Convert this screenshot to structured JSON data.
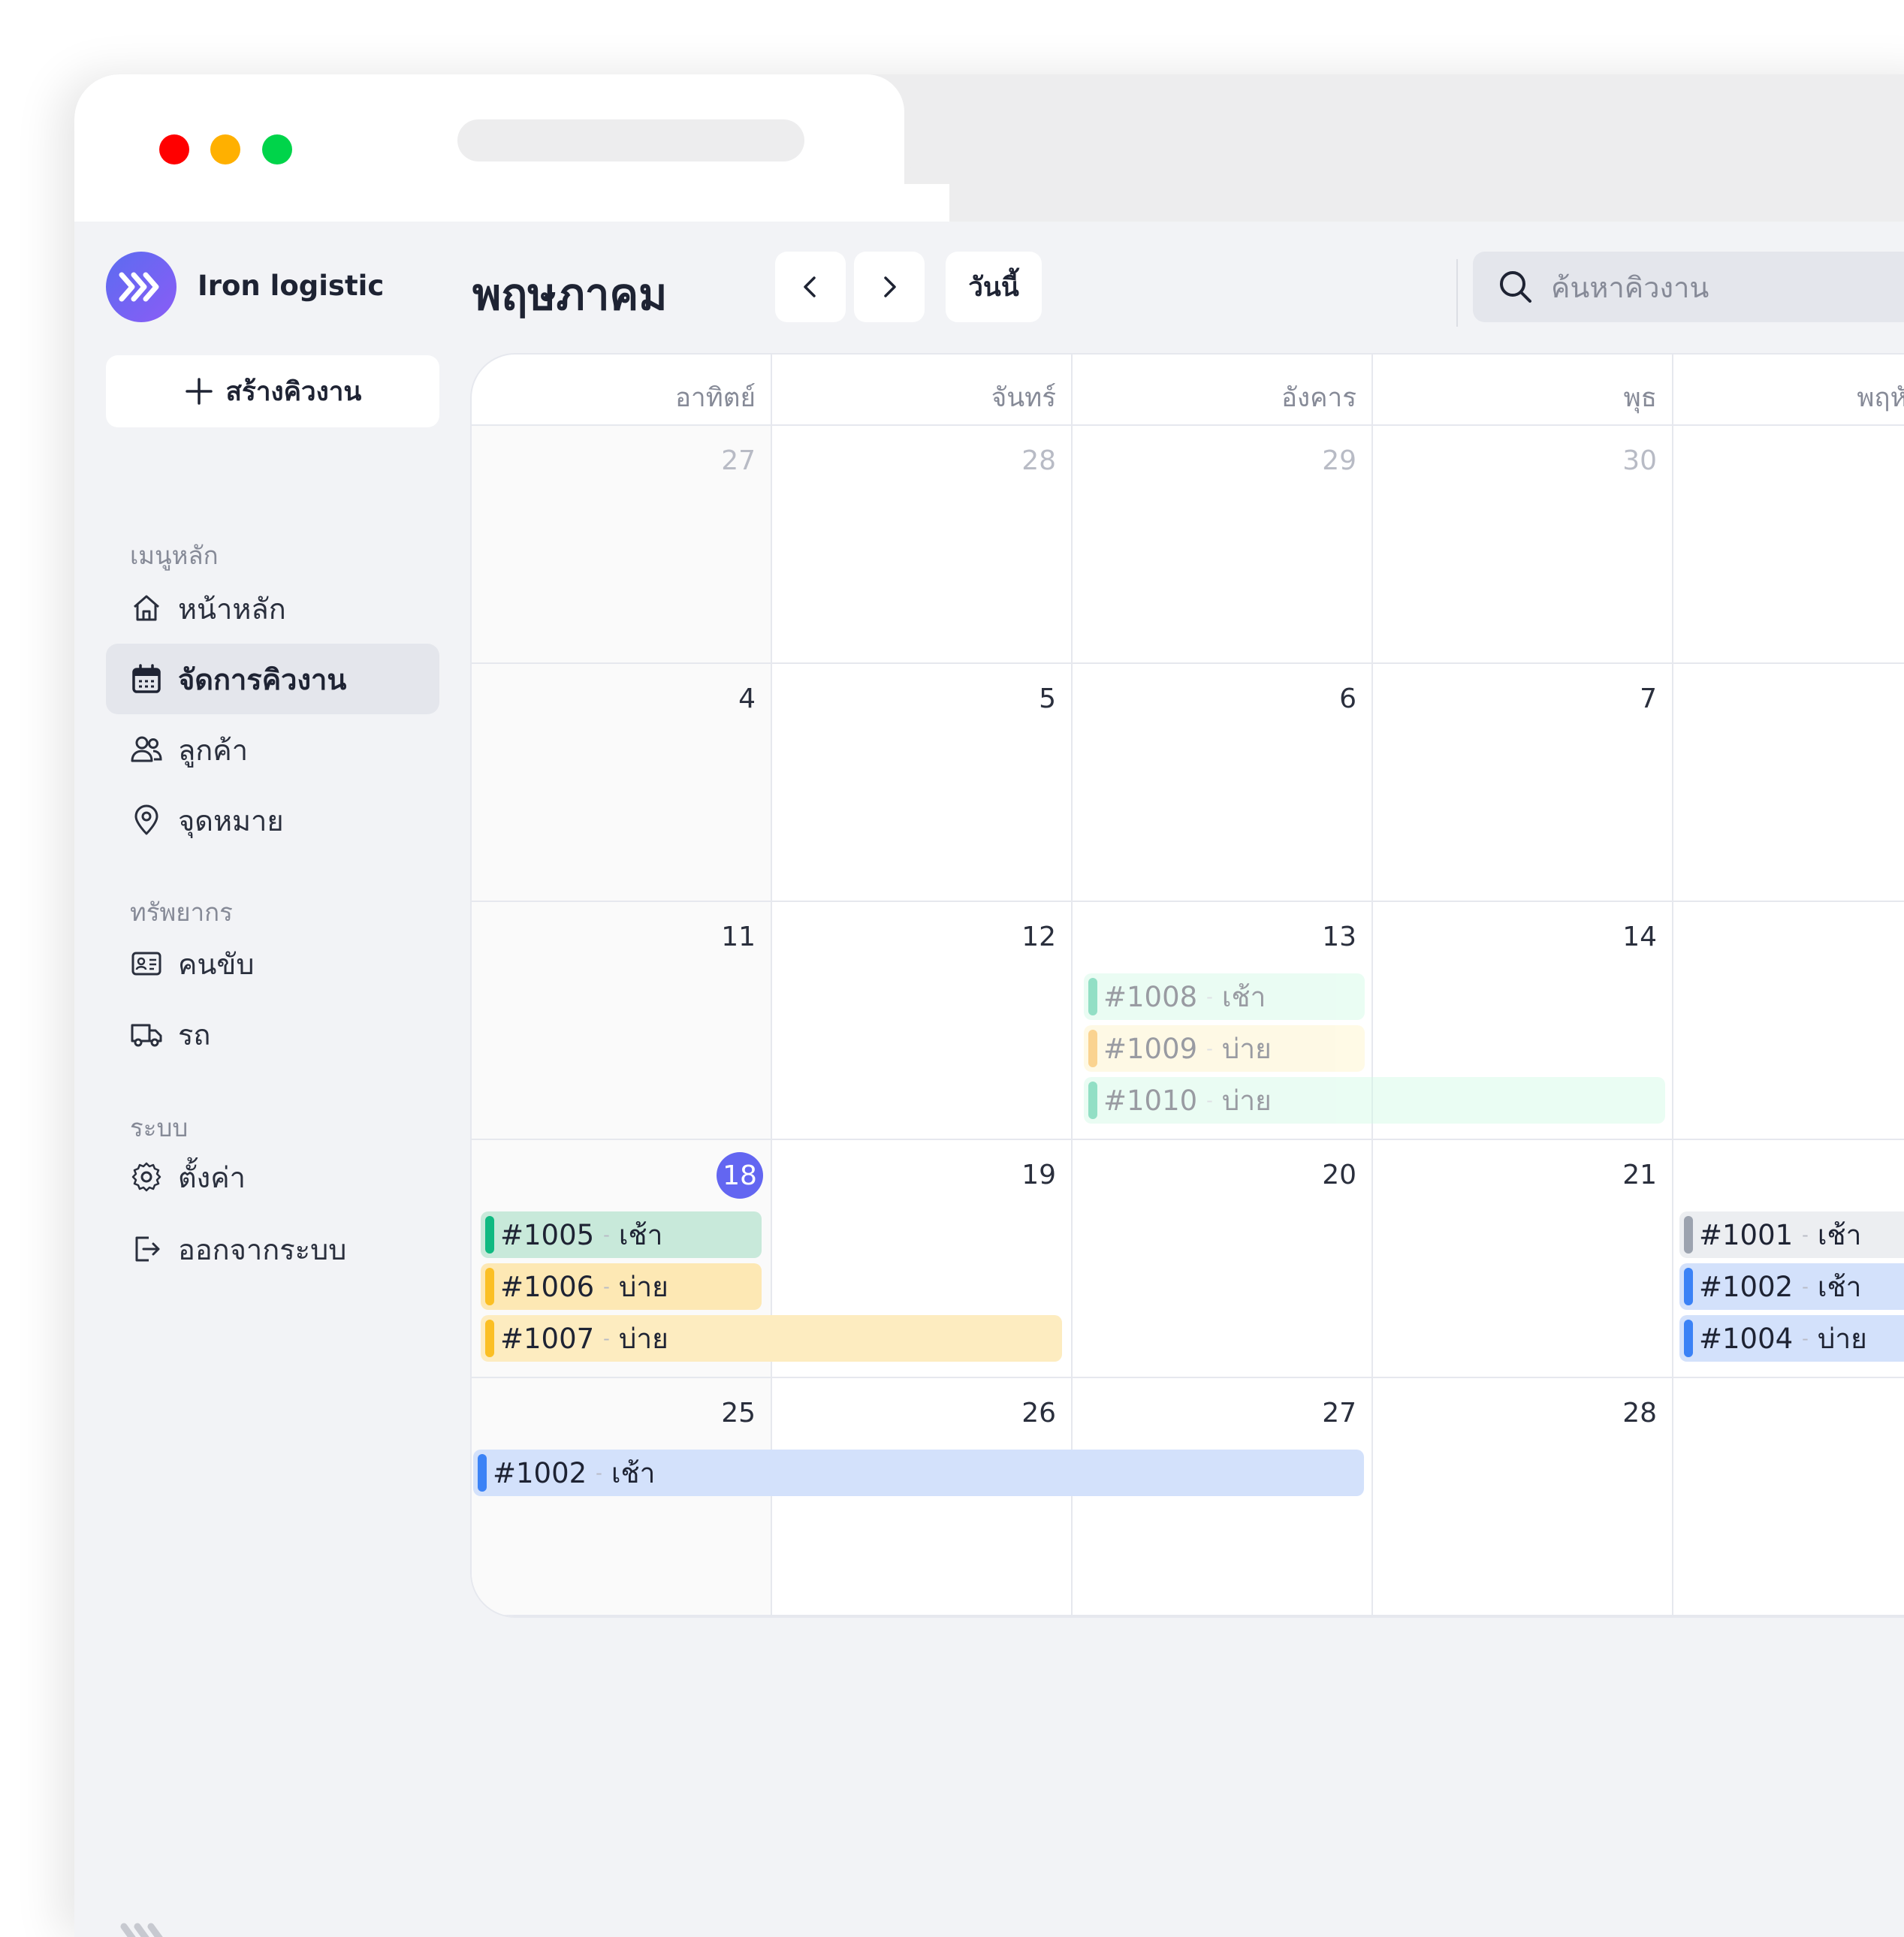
{
  "app": {
    "name": "Iron logistic",
    "create_label": "สร้างคิวงาน"
  },
  "sidebar": {
    "sections": [
      {
        "label": "เมนูหลัก",
        "items": [
          {
            "label": "หน้าหลัก",
            "icon": "home-icon"
          },
          {
            "label": "จัดการคิวงาน",
            "icon": "calendar-icon",
            "active": true
          },
          {
            "label": "ลูกค้า",
            "icon": "users-icon"
          },
          {
            "label": "จุดหมาย",
            "icon": "map-pin-icon"
          }
        ]
      },
      {
        "label": "ทรัพยากร",
        "items": [
          {
            "label": "คนขับ",
            "icon": "id-card-icon"
          },
          {
            "label": "รถ",
            "icon": "truck-icon"
          }
        ]
      },
      {
        "label": "ระบบ",
        "items": [
          {
            "label": "ตั้งค่า",
            "icon": "gear-icon"
          },
          {
            "label": "ออกจากระบบ",
            "icon": "logout-icon"
          }
        ]
      }
    ]
  },
  "header": {
    "month": "พฤษภาคม",
    "today_label": "วันนี้",
    "search_placeholder": "ค้นหาคิวงาน"
  },
  "calendar": {
    "weekdays": [
      "อาทิตย์",
      "จันทร์",
      "อังคาร",
      "พุธ",
      "พฤหัสบดี"
    ],
    "weeks": [
      [
        "27",
        "28",
        "29",
        "30",
        ""
      ],
      [
        "4",
        "5",
        "6",
        "7",
        ""
      ],
      [
        "11",
        "12",
        "13",
        "14",
        ""
      ],
      [
        "18",
        "19",
        "20",
        "21",
        ""
      ],
      [
        "25",
        "26",
        "27",
        "28",
        ""
      ]
    ],
    "today": "18",
    "events": [
      {
        "id": "#1008",
        "shift": "เช้า",
        "color": "#10b981",
        "bg": "#d1fae5",
        "faded": true
      },
      {
        "id": "#1009",
        "shift": "บ่าย",
        "color": "#f59e0b",
        "bg": "#fef3c7",
        "faded": true
      },
      {
        "id": "#1010",
        "shift": "บ่าย",
        "color": "#10b981",
        "bg": "#d1fae5",
        "faded": true
      },
      {
        "id": "#1005",
        "shift": "เช้า",
        "color": "#10b981",
        "bg": "#c8e9da"
      },
      {
        "id": "#1006",
        "shift": "บ่าย",
        "color": "#fbbf24",
        "bg": "#fde8b4"
      },
      {
        "id": "#1007",
        "shift": "บ่าย",
        "color": "#fbbf24",
        "bg": "#fdecc0"
      },
      {
        "id": "#1001",
        "shift": "เช้า",
        "color": "#9ca3af",
        "bg": "#eceef1"
      },
      {
        "id": "#1002",
        "shift": "เช้า",
        "color": "#3b82f6",
        "bg": "#d3e1fb"
      },
      {
        "id": "#1004",
        "shift": "บ่าย",
        "color": "#3b82f6",
        "bg": "#d3e1fb"
      },
      {
        "id": "#1002",
        "shift": "เช้า",
        "color": "#3b82f6",
        "bg": "#d3e1fb"
      }
    ]
  },
  "colors": {
    "accent": "#6366f1",
    "traffic_red": "#ff0000",
    "traffic_yellow": "#ffb000",
    "traffic_green": "#00d44a"
  }
}
